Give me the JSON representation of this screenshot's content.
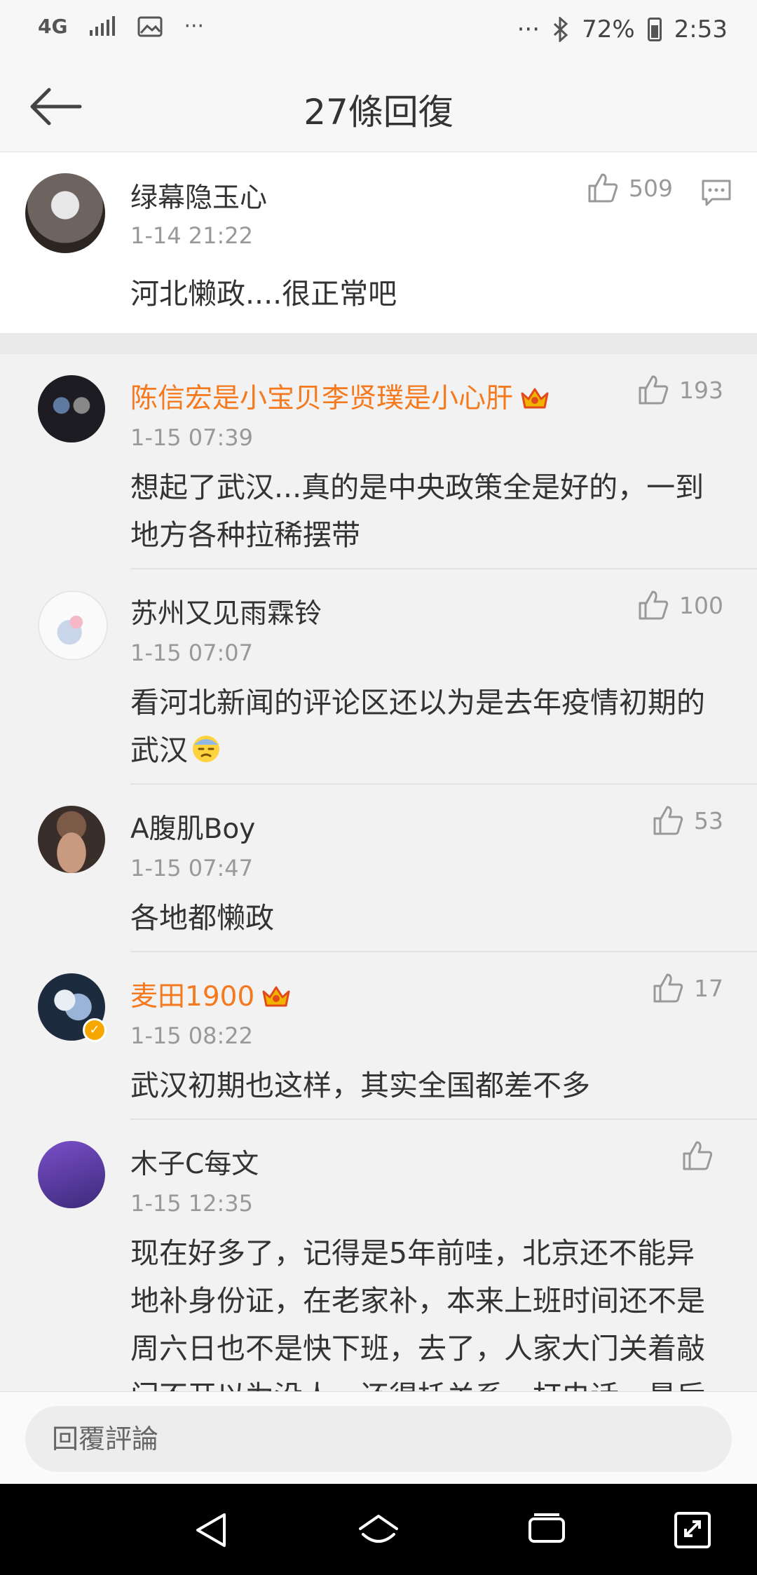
{
  "status_bar": {
    "network": "4G",
    "more_left": "···",
    "more_right": "···",
    "battery": "72%",
    "time": "2:53"
  },
  "header": {
    "title": "27條回復"
  },
  "main_comment": {
    "name": "绿幕隐玉心",
    "time": "1-14 21:22",
    "likes": "509",
    "text": "河北懒政....很正常吧"
  },
  "replies": [
    {
      "name": "陈信宏是小宝贝李贤璞是小心肝",
      "time": "1-15 07:39",
      "likes": "193",
      "text_line1": "想起了武汉...真的是中央政策全是好的，一到",
      "text_line2": "地方各种拉稀摆带",
      "vip": true
    },
    {
      "name": "苏州又见雨霖铃",
      "time": "1-15 07:07",
      "likes": "100",
      "text_line1": "看河北新闻的评论区还以为是去年疫情初期的",
      "text_line2": "武汉"
    },
    {
      "name": "A腹肌Boy",
      "time": "1-15 07:47",
      "likes": "53",
      "text_line1": "各地都懒政"
    },
    {
      "name": "麦田1900",
      "time": "1-15 08:22",
      "likes": "17",
      "text_line1": "武汉初期也这样，其实全国都差不多",
      "vip": true,
      "verified": true
    },
    {
      "name": "木子C每文",
      "time": "1-15 12:35",
      "likes": "",
      "text_line1": "现在好多了，记得是5年前哇，北京还不能异",
      "text_line2": "地补身份证，在老家补，本来上班时间还不是",
      "text_line3": "周六日也不是快下班，去了，人家大门关着敲",
      "text_line4": "门不开以为没人，还得托关系，打电话，最后"
    }
  ],
  "reply_bar": {
    "placeholder": "回覆評論"
  },
  "colors": {
    "orange_name": "#f57a1f",
    "grey_text": "#999999",
    "background": "#f2f2f2"
  }
}
